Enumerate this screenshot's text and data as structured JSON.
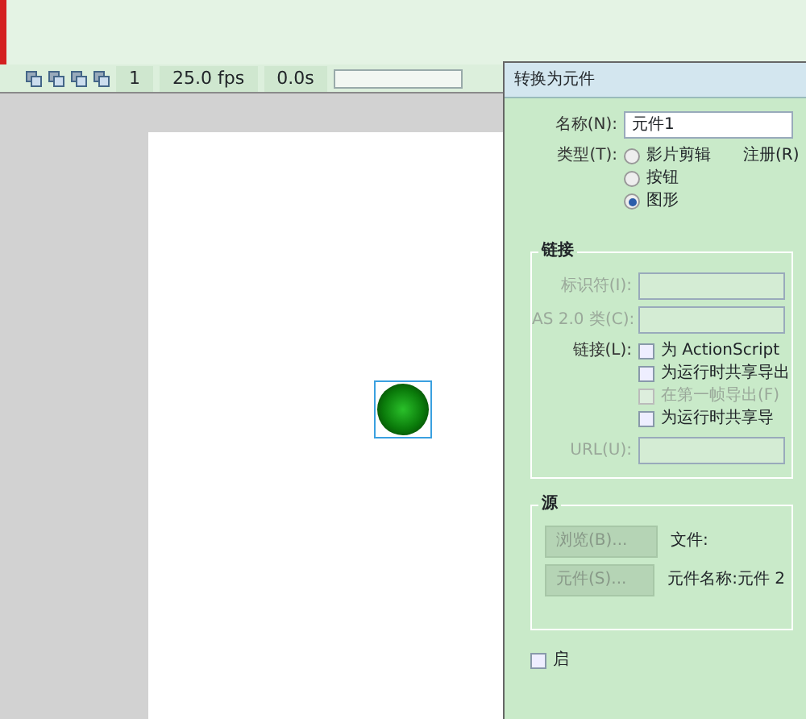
{
  "toolbar": {
    "frame": "1",
    "fps": "25.0 fps",
    "time": "0.0s"
  },
  "dialog": {
    "title": "转换为元件",
    "name": {
      "label": "名称(N):",
      "value": "元件1"
    },
    "type": {
      "label": "类型(T):",
      "options": [
        {
          "label": "影片剪辑",
          "selected": false
        },
        {
          "label": "按钮",
          "selected": false
        },
        {
          "label": "图形",
          "selected": true
        }
      ],
      "registration": "注册(R)"
    },
    "linkage": {
      "legend": "链接",
      "fields": [
        {
          "label": "标识符(I):",
          "disabled": true
        },
        {
          "label": "AS 2.0 类(C):",
          "disabled": true
        }
      ],
      "checks_label": "链接(L):",
      "checks": [
        {
          "label": "为 ActionScript",
          "checked": false,
          "disabled": false
        },
        {
          "label": "为运行时共享导出",
          "checked": false,
          "disabled": false
        },
        {
          "label": "在第一帧导出(F)",
          "checked": false,
          "disabled": true
        },
        {
          "label": "为运行时共享导",
          "checked": false,
          "disabled": false
        }
      ],
      "url": {
        "label": "URL(U):",
        "disabled": true
      }
    },
    "source": {
      "legend": "源",
      "rows": [
        {
          "button": "浏览(B)...",
          "text": "文件:"
        },
        {
          "button": "元件(S)...",
          "text": "元件名称:元件 2"
        }
      ]
    },
    "bottom_check": {
      "label": "启",
      "checked": false
    }
  }
}
